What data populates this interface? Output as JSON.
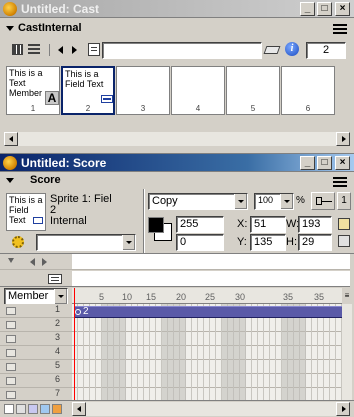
{
  "cast_window": {
    "title": "Untitled: Cast",
    "cast_name": "CastInternal",
    "member_number": "2",
    "members": [
      {
        "number": "1",
        "thumb_text": "This is a Text Member",
        "badge": "A"
      },
      {
        "number": "2",
        "thumb_text": "This is a Field Text",
        "badge": "field"
      },
      {
        "number": "3",
        "thumb_text": ""
      },
      {
        "number": "4",
        "thumb_text": ""
      },
      {
        "number": "5",
        "thumb_text": ""
      },
      {
        "number": "6",
        "thumb_text": ""
      }
    ]
  },
  "score_window": {
    "title": "Untitled: Score",
    "panel_label": "Score",
    "sprite_thumb_text": "This is a Field Text",
    "sprite_info": {
      "line1": "Sprite 1: Fiel",
      "line2": "2",
      "line3": "Internal"
    },
    "ink": "Copy",
    "blend": "100",
    "blend_unit": "%",
    "foreground_value": "255",
    "background_value": "0",
    "x_label": "X:",
    "x_value": "51",
    "y_label": "Y:",
    "y_value": "135",
    "w_label": "W:",
    "w_value": "193",
    "h_label": "H:",
    "h_value": "29",
    "channel_dropdown": "Member",
    "frame_ticks": [
      "5",
      "10",
      "15",
      "20",
      "25",
      "30",
      "35"
    ],
    "channels": [
      "1",
      "2",
      "3",
      "4",
      "5",
      "6",
      "7"
    ],
    "sprite_span_label": "2",
    "right_field": "1"
  },
  "colors": {
    "active_title": "#0a246a",
    "sprite_bar": "#5a5aa8",
    "playhead": "#ff0000"
  }
}
